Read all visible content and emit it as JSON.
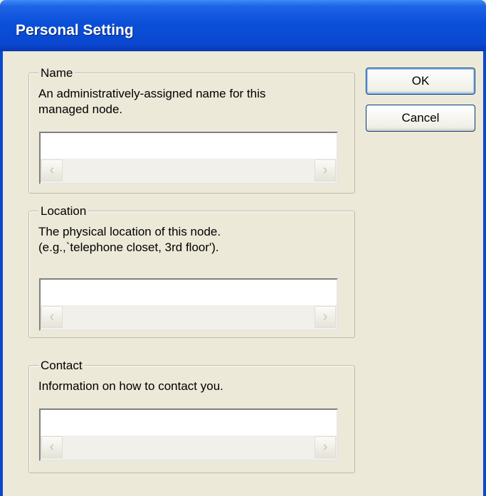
{
  "window": {
    "title": "Personal Setting"
  },
  "buttons": {
    "ok_label": "OK",
    "cancel_label": "Cancel"
  },
  "groups": {
    "name": {
      "legend": "Name",
      "desc_line1": "An administratively-assigned name for this",
      "desc_line2": "managed node.",
      "value": ""
    },
    "location": {
      "legend": "Location",
      "desc_line1": "The physical location of this node.",
      "desc_line2": "(e.g.,`telephone closet, 3rd floor').",
      "value": ""
    },
    "contact": {
      "legend": "Contact",
      "desc_line1": "Information on how to contact you.",
      "value": ""
    }
  },
  "icons": {
    "scroll_left": "chevron-left-icon",
    "scroll_right": "chevron-right-icon"
  }
}
